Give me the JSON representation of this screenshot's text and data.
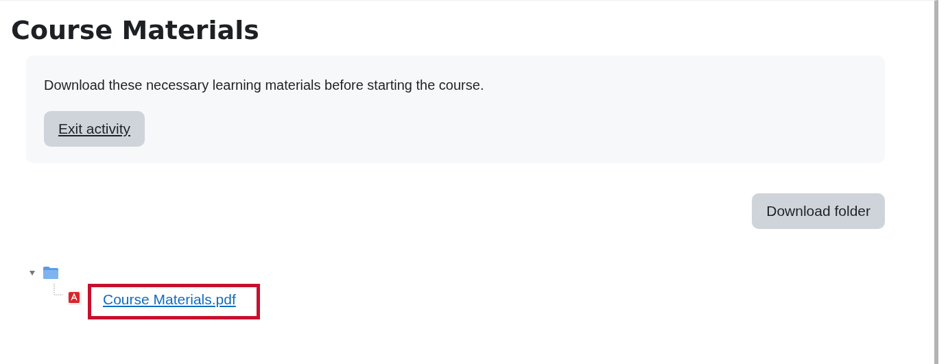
{
  "page": {
    "title": "Course Materials"
  },
  "intro": {
    "text": "Download these necessary learning materials before starting the course.",
    "button": "Exit activity"
  },
  "actions": {
    "download_button": "Download folder"
  },
  "tree": [
    {
      "kind": "folder",
      "expanded": true,
      "children": [
        {
          "kind": "pdf",
          "name": "Course Materials.pdf",
          "highlighted": true
        }
      ]
    }
  ]
}
